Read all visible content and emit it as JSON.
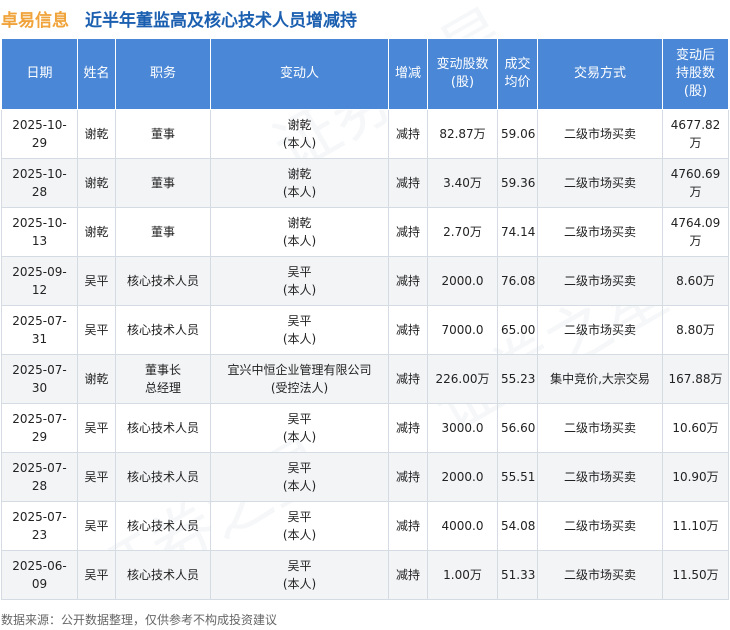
{
  "title": {
    "company": "卓易信息",
    "text": "近半年董监高及核心技术人员增减持"
  },
  "headers": {
    "date": "日期",
    "name": "姓名",
    "position": "职务",
    "changer": "变动人",
    "direction": "增减",
    "shares": [
      "变动股数",
      "(股)"
    ],
    "price": [
      "成交",
      "均价"
    ],
    "method": "交易方式",
    "after": [
      "变动后",
      "持股数",
      "(股)"
    ]
  },
  "rows": [
    {
      "date": "2025-10-29",
      "name": "谢乾",
      "position": [
        "董事"
      ],
      "changer": [
        "谢乾",
        "(本人)"
      ],
      "direction": "减持",
      "shares": "82.87万",
      "price": "59.06",
      "method": "二级市场买卖",
      "after": "4677.82万"
    },
    {
      "date": "2025-10-28",
      "name": "谢乾",
      "position": [
        "董事"
      ],
      "changer": [
        "谢乾",
        "(本人)"
      ],
      "direction": "减持",
      "shares": "3.40万",
      "price": "59.36",
      "method": "二级市场买卖",
      "after": "4760.69万"
    },
    {
      "date": "2025-10-13",
      "name": "谢乾",
      "position": [
        "董事"
      ],
      "changer": [
        "谢乾",
        "(本人)"
      ],
      "direction": "减持",
      "shares": "2.70万",
      "price": "74.14",
      "method": "二级市场买卖",
      "after": "4764.09万"
    },
    {
      "date": "2025-09-12",
      "name": "吴平",
      "position": [
        "核心技术人员"
      ],
      "changer": [
        "吴平",
        "(本人)"
      ],
      "direction": "减持",
      "shares": "2000.0",
      "price": "76.08",
      "method": "二级市场买卖",
      "after": "8.60万"
    },
    {
      "date": "2025-07-31",
      "name": "吴平",
      "position": [
        "核心技术人员"
      ],
      "changer": [
        "吴平",
        "(本人)"
      ],
      "direction": "减持",
      "shares": "7000.0",
      "price": "65.00",
      "method": "二级市场买卖",
      "after": "8.80万"
    },
    {
      "date": "2025-07-30",
      "name": "谢乾",
      "position": [
        "董事长",
        "总经理"
      ],
      "changer": [
        "宜兴中恒企业管理有限公司",
        "(受控法人)"
      ],
      "direction": "减持",
      "shares": "226.00万",
      "price": "55.23",
      "method": "集中竞价,大宗交易",
      "after": "167.88万"
    },
    {
      "date": "2025-07-29",
      "name": "吴平",
      "position": [
        "核心技术人员"
      ],
      "changer": [
        "吴平",
        "(本人)"
      ],
      "direction": "减持",
      "shares": "3000.0",
      "price": "56.60",
      "method": "二级市场买卖",
      "after": "10.60万"
    },
    {
      "date": "2025-07-28",
      "name": "吴平",
      "position": [
        "核心技术人员"
      ],
      "changer": [
        "吴平",
        "(本人)"
      ],
      "direction": "减持",
      "shares": "2000.0",
      "price": "55.51",
      "method": "二级市场买卖",
      "after": "10.90万"
    },
    {
      "date": "2025-07-23",
      "name": "吴平",
      "position": [
        "核心技术人员"
      ],
      "changer": [
        "吴平",
        "(本人)"
      ],
      "direction": "减持",
      "shares": "4000.0",
      "price": "54.08",
      "method": "二级市场买卖",
      "after": "11.10万"
    },
    {
      "date": "2025-06-09",
      "name": "吴平",
      "position": [
        "核心技术人员"
      ],
      "changer": [
        "吴平",
        "(本人)"
      ],
      "direction": "减持",
      "shares": "1.00万",
      "price": "51.33",
      "method": "二级市场买卖",
      "after": "11.50万"
    }
  ],
  "footer": "数据来源：公开数据整理，仅供参考不构成投资建议",
  "colors": {
    "header_bg": "#4a87d6",
    "title_company": "#f0a33a",
    "title_text": "#1b5fb0",
    "decrease": "#1f9a33"
  }
}
